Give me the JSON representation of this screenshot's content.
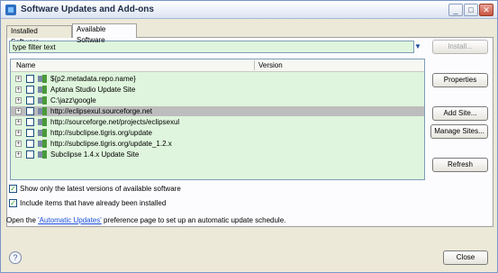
{
  "window": {
    "title": "Software Updates and Add-ons",
    "controls": {
      "minimize": "_",
      "maximize": "□",
      "close": "✕"
    }
  },
  "tabs": [
    {
      "label": "Installed Software",
      "selected": false
    },
    {
      "label": "Available Software",
      "selected": true
    }
  ],
  "filter": {
    "value": "type filter text",
    "dropdown_icon": "▼"
  },
  "tree": {
    "columns": [
      "Name",
      "Version"
    ],
    "rows": [
      {
        "label": "${p2.metadata.repo.name}",
        "expander": "+",
        "checked": false,
        "selected": false
      },
      {
        "label": "Aptana Studio Update Site",
        "expander": "+",
        "checked": false,
        "selected": false
      },
      {
        "label": "C:\\jazz\\google",
        "expander": "+",
        "checked": false,
        "selected": false
      },
      {
        "label": "http://eclipsexul.sourceforge.net",
        "expander": "+",
        "checked": false,
        "selected": true
      },
      {
        "label": "http://sourceforge.net/projects/eclipsexul",
        "expander": "+",
        "checked": false,
        "selected": false
      },
      {
        "label": "http://subclipse.tigris.org/update",
        "expander": "+",
        "checked": false,
        "selected": false
      },
      {
        "label": "http://subclipse.tigris.org/update_1.2.x",
        "expander": "+",
        "checked": false,
        "selected": false
      },
      {
        "label": "Subclipse 1.4.x Update Site",
        "expander": "+",
        "checked": false,
        "selected": false
      }
    ]
  },
  "buttons": {
    "install": "Install...",
    "properties": "Properties",
    "add_site": "Add Site...",
    "manage_sites": "Manage Sites...",
    "refresh": "Refresh",
    "close": "Close"
  },
  "options": {
    "show_latest": {
      "label": "Show only the latest versions of available software",
      "checked": true
    },
    "include_installed": {
      "label": "Include items that have already been installed",
      "checked": true
    }
  },
  "prefs": {
    "prefix": "Open the ",
    "link": "'Automatic Updates'",
    "suffix": " preference page to set up an automatic update schedule."
  },
  "help": {
    "icon": "?"
  },
  "colors": {
    "tree_background": "#dff5dd",
    "selected_row": "#bdbdbd",
    "link": "#1a4fd8"
  }
}
